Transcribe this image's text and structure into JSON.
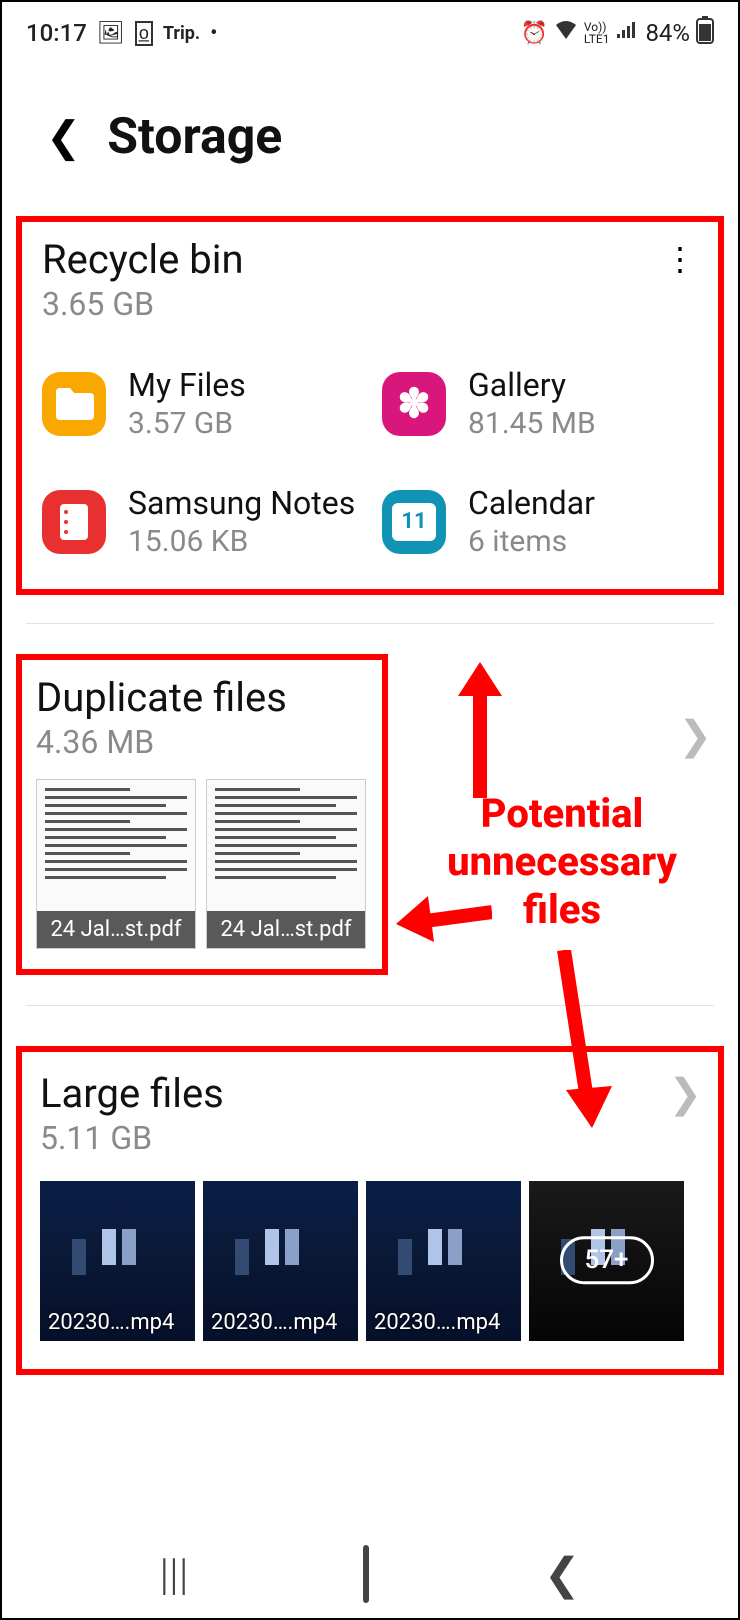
{
  "status_bar": {
    "time": "10:17",
    "left_icons": [
      "image-icon",
      "app-icon",
      "trip-icon",
      "dot-icon"
    ],
    "trip_label": "Trip.",
    "lte_label": "Vo))\nLTE1",
    "battery": "84%"
  },
  "header": {
    "title": "Storage"
  },
  "recycle_bin": {
    "title": "Recycle bin",
    "size": "3.65 GB",
    "apps": [
      {
        "name": "My Files",
        "size": "3.57 GB",
        "icon": "folder-icon",
        "color": "myfiles"
      },
      {
        "name": "Gallery",
        "size": "81.45 MB",
        "icon": "gallery-icon",
        "color": "gallery"
      },
      {
        "name": "Samsung Notes",
        "size": "15.06 KB",
        "icon": "notes-icon",
        "color": "notes"
      },
      {
        "name": "Calendar",
        "size": "6 items",
        "icon": "calendar-icon",
        "color": "calendar"
      }
    ]
  },
  "duplicate_files": {
    "title": "Duplicate files",
    "size": "4.36 MB",
    "items": [
      {
        "label": "24 Jal…st.pdf"
      },
      {
        "label": "24 Jal…st.pdf"
      }
    ]
  },
  "large_files": {
    "title": "Large files",
    "size": "5.11 GB",
    "items": [
      {
        "label": "20230….mp4"
      },
      {
        "label": "20230….mp4"
      },
      {
        "label": "20230….mp4"
      },
      {
        "label": "",
        "more": "57+"
      }
    ]
  },
  "annotation": {
    "text": "Potential unnecessary files"
  },
  "calendar_day": "11"
}
